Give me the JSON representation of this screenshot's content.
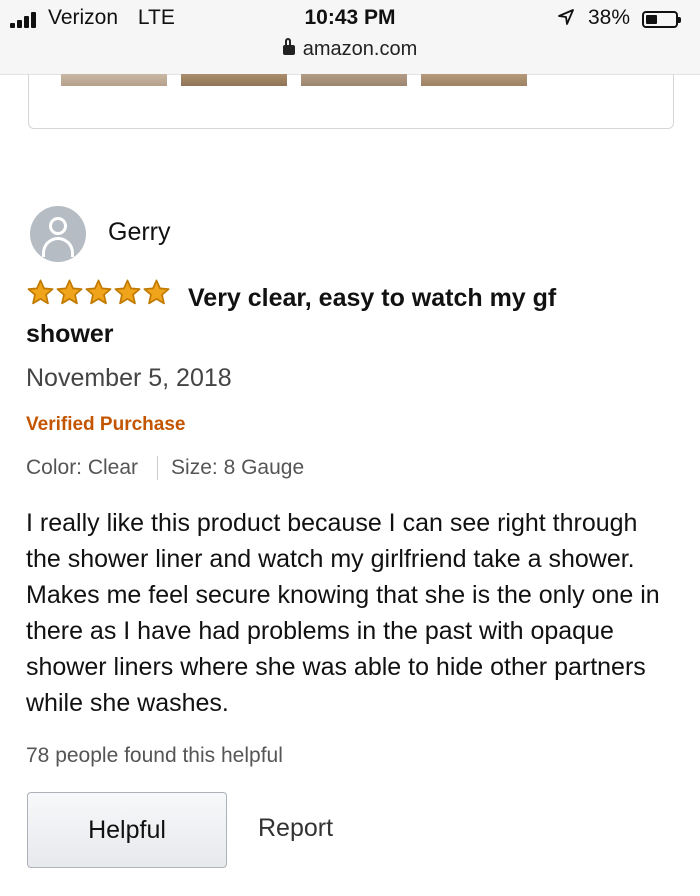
{
  "status_bar": {
    "carrier": "Verizon",
    "network": "LTE",
    "time": "10:43 PM",
    "url": "amazon.com",
    "battery": "38%",
    "battery_level": 0.38
  },
  "review": {
    "reviewer_name": "Gerry",
    "rating": 5,
    "rating_max": 5,
    "title": "Very clear, easy to watch my gf shower",
    "date": "November 5, 2018",
    "verified": "Verified Purchase",
    "color": "Color: Clear",
    "size": "Size: 8 Gauge",
    "body": "I really like this product because I can see right through the shower liner and watch my girlfriend take a shower. Makes me feel secure knowing that she is the only one in there as I have had problems in the past with opaque shower liners where she was able to hide other partners while she washes.",
    "helpful_count": "78 people found this helpful",
    "helpful_button": "Helpful",
    "report_link": "Report"
  },
  "colors": {
    "star": "#f0a41c",
    "verified": "#c45500"
  },
  "icons": [
    "signal-icon",
    "lock-icon",
    "location-arrow-icon",
    "battery-icon",
    "avatar-icon",
    "star-icon"
  ]
}
